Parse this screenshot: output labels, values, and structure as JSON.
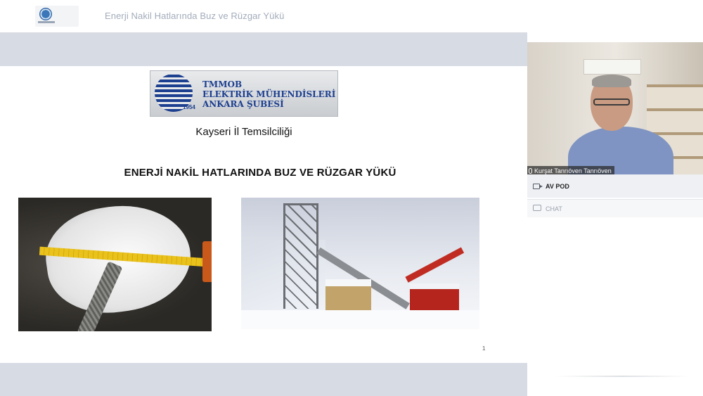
{
  "header": {
    "logo_icon": "emo-logo-icon",
    "meeting_title": "Enerji Nakil Hatlarında Buz ve Rüzgar Yükü"
  },
  "slide": {
    "logo": {
      "line1": "TMMOB",
      "line2": "ELEKTRİK MÜHENDİSLERİ ODASI",
      "line3": "ANKARA ŞUBESİ",
      "year": "1954"
    },
    "subtitle": "Kayseri İl Temsilciliği",
    "heading": "ENERJİ NAKİL HATLARINDA BUZ VE RÜZGAR YÜKÜ",
    "page_number": "1"
  },
  "video": {
    "participant_name": "Kurşat Tanrıöven Tanrıöven"
  },
  "panels": {
    "av_pod_label": "AV POD",
    "chat_label": "CHAT"
  },
  "colors": {
    "stage_bg": "#d7dbe3",
    "emo_blue": "#1d3f8f",
    "title_gray": "#a3acbb"
  }
}
